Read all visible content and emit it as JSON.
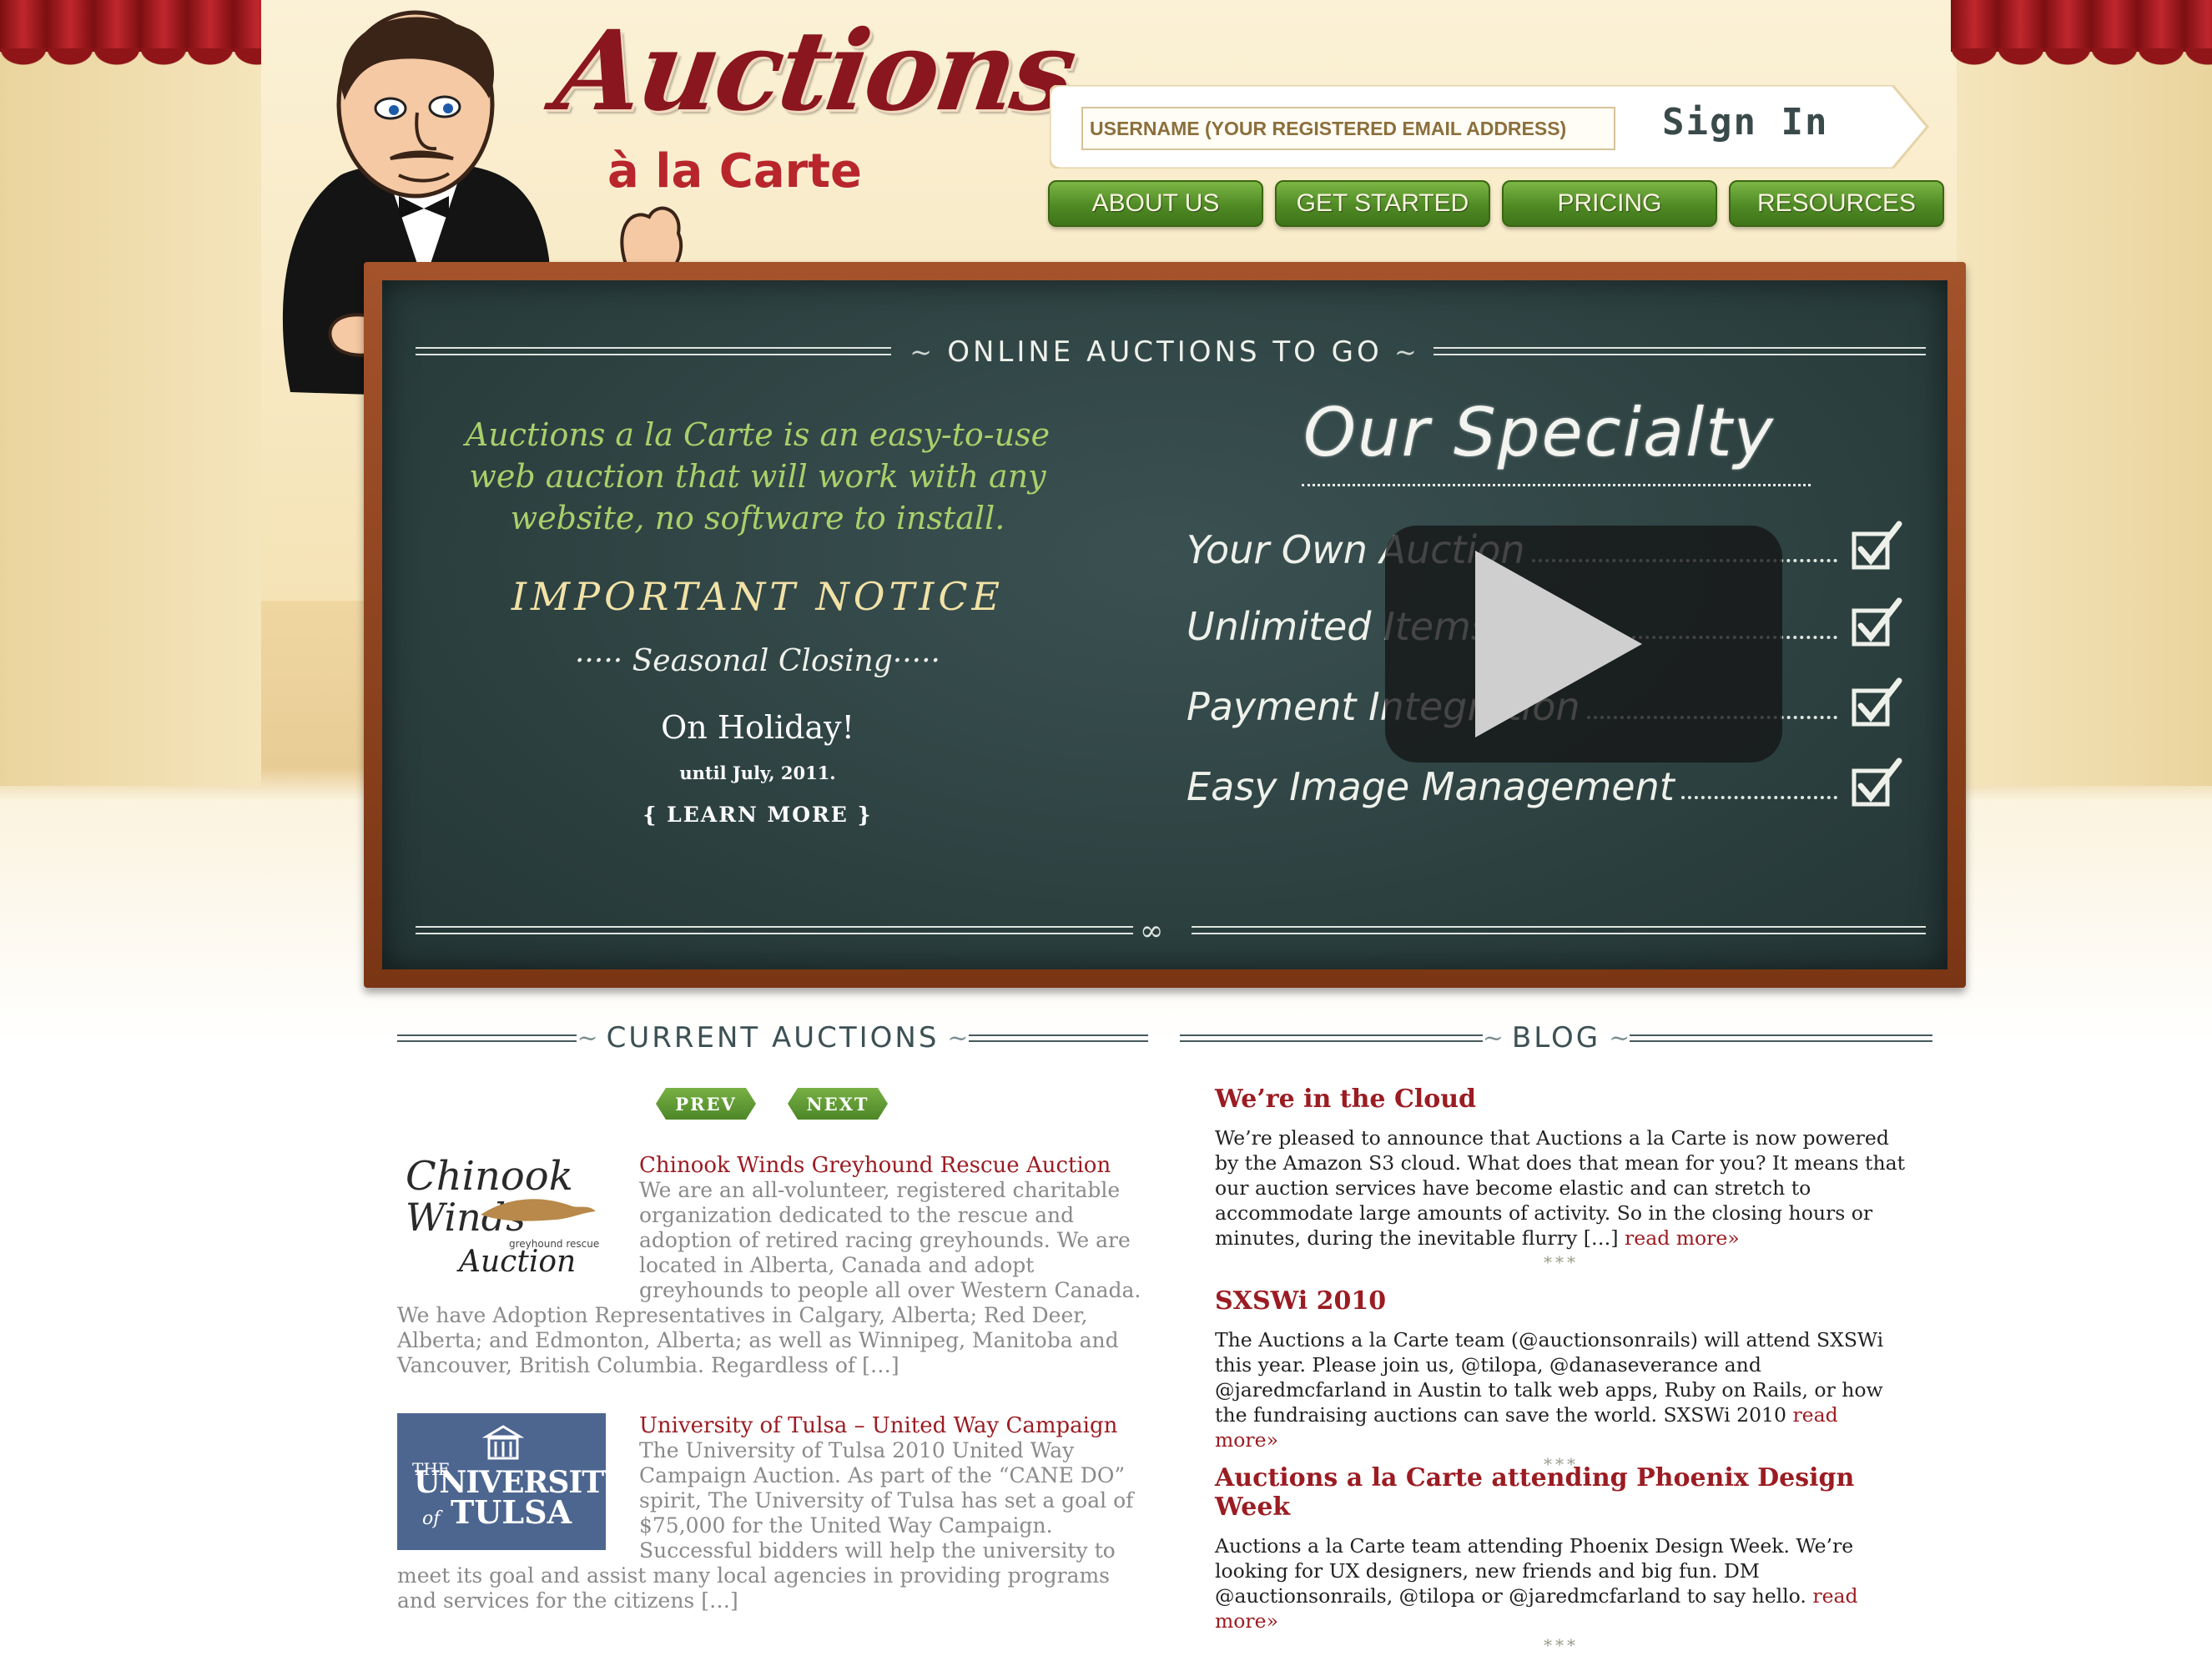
{
  "header": {
    "logo_main": "Auctions",
    "logo_sub": "à la Carte",
    "signin": {
      "username_placeholder": "USERNAME (YOUR REGISTERED EMAIL ADDRESS)",
      "button_label": "Sign In"
    },
    "nav": [
      {
        "label": "ABOUT US"
      },
      {
        "label": "GET STARTED"
      },
      {
        "label": "PRICING"
      },
      {
        "label": "RESOURCES"
      }
    ]
  },
  "hero": {
    "title": "ONLINE AUCTIONS TO GO",
    "tagline": "Auctions a la Carte is an easy-to-use web auction that will work with any website, no software to install.",
    "notice_heading": "IMPORTANT NOTICE",
    "notice_sub": "····· Seasonal Closing·····",
    "notice_holiday": "On Holiday!",
    "notice_until": "until July, 2011.",
    "learn_more": "{ LEARN MORE }",
    "specialty_title": "Our Specialty",
    "specialties": [
      {
        "label": "Your Own Auction"
      },
      {
        "label": "Unlimited Items"
      },
      {
        "label": "Payment Integration"
      },
      {
        "label": "Easy Image Management"
      }
    ]
  },
  "auctions": {
    "heading": "CURRENT AUCTIONS",
    "prev_label": "PREV",
    "next_label": "NEXT",
    "items": [
      {
        "title": "Chinook Winds Greyhound Rescue Auction",
        "description": "We are an all-volunteer, registered charitable organization dedicated to the rescue and adoption of retired racing greyhounds. We are located in Alberta, Canada and adopt greyhounds to people all over Western Canada. We have Adoption Representatives in Calgary, Alberta; Red Deer, Alberta; and Edmonton, Alberta; as well as Winnipeg, Manitoba and Vancouver, British Columbia. Regardless of […]",
        "logo_text_1": "Chinook",
        "logo_text_2": "Winds",
        "logo_text_3": "greyhound rescue",
        "logo_text_4": "Auction"
      },
      {
        "title": "University of Tulsa – United Way Campaign",
        "description": "The University of Tulsa 2010 United Way Campaign Auction. As part of the “CANE DO” spirit, The University of Tulsa has set a goal of $75,000 for the United Way Campaign. Successful bidders will help the university to meet its goal and assist many local agencies in providing programs and services for the citizens […]",
        "logo_text_1": "THE",
        "logo_text_2": "UNIVERSITY",
        "logo_text_3": "of",
        "logo_text_4": "TULSA"
      }
    ]
  },
  "blog": {
    "heading": "BLOG",
    "posts": [
      {
        "title": "We’re in the Cloud",
        "body": "We’re pleased to announce that Auctions a la Carte is now powered by the Amazon S3 cloud. What does that mean for you? It means that our auction services have become elastic and can stretch to accommodate large amounts of activity. So in the closing hours or minutes, during the inevitable flurry […]",
        "read_more": "read more»"
      },
      {
        "title": "SXSWi 2010",
        "body": "The Auctions a la Carte team (@auctionsonrails) will attend SXSWi this year. Please join us, @tilopa, @danaseverance and @jaredmcfarland in Austin to talk web apps, Ruby on Rails, or how the fundraising auctions can save the world. SXSWi 2010",
        "read_more": "read more»"
      },
      {
        "title": "Auctions a la Carte attending Phoenix Design Week",
        "body": "Auctions a la Carte team attending Phoenix Design Week. We’re looking for UX designers, new friends and big fun. DM @auctionsonrails, @tilopa or @jaredmcfarland to say hello.",
        "read_more": "read more»"
      }
    ],
    "separator": "***"
  },
  "colors": {
    "brand_red": "#9b1c22",
    "nav_green": "#4f8a24",
    "chalkboard": "#2e4242",
    "tagline_green": "#a8d06a"
  }
}
